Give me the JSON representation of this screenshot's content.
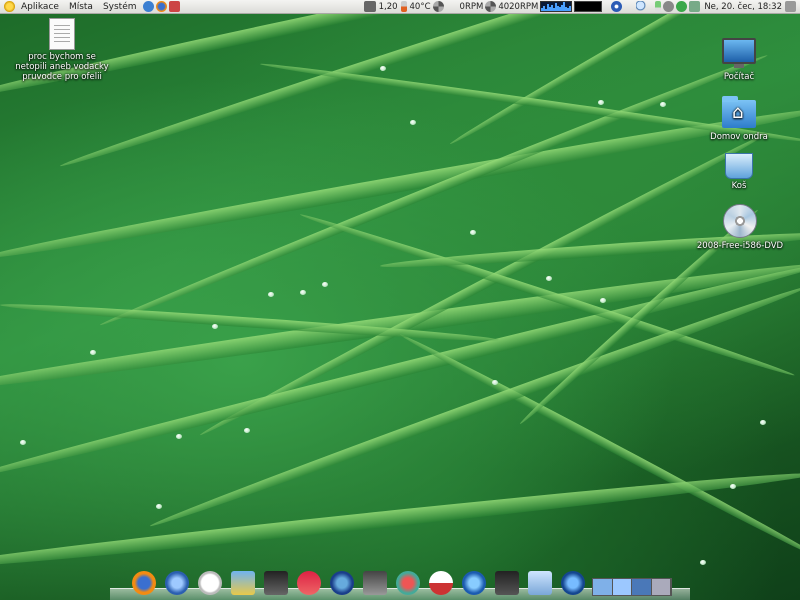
{
  "top_panel": {
    "menus": [
      "Aplikace",
      "Místa",
      "Systém"
    ],
    "load": "1,20",
    "temperature": "40°C",
    "fan1": "0RPM",
    "fan2": "4020RPM",
    "clock": "Ne, 20. čec, 18:32"
  },
  "desktop": {
    "document_label": "proc bychom se netopili aneb vodacky pruvodce pro ofelii",
    "computer_label": "Počítač",
    "home_label": "Domov ondra",
    "trash_label": "Koš",
    "disc_label": "2008-Free-i586-DVD"
  },
  "dock": {
    "icons": [
      "firefox-icon",
      "thunderbird-icon",
      "clock-icon",
      "image-viewer-icon",
      "movie-icon",
      "presentation-icon",
      "google-earth-icon",
      "terminal-icon",
      "network-icon",
      "home-folder-icon",
      "web-globe-icon",
      "system-monitor-icon",
      "disk-icon",
      "network-manager-icon"
    ]
  }
}
